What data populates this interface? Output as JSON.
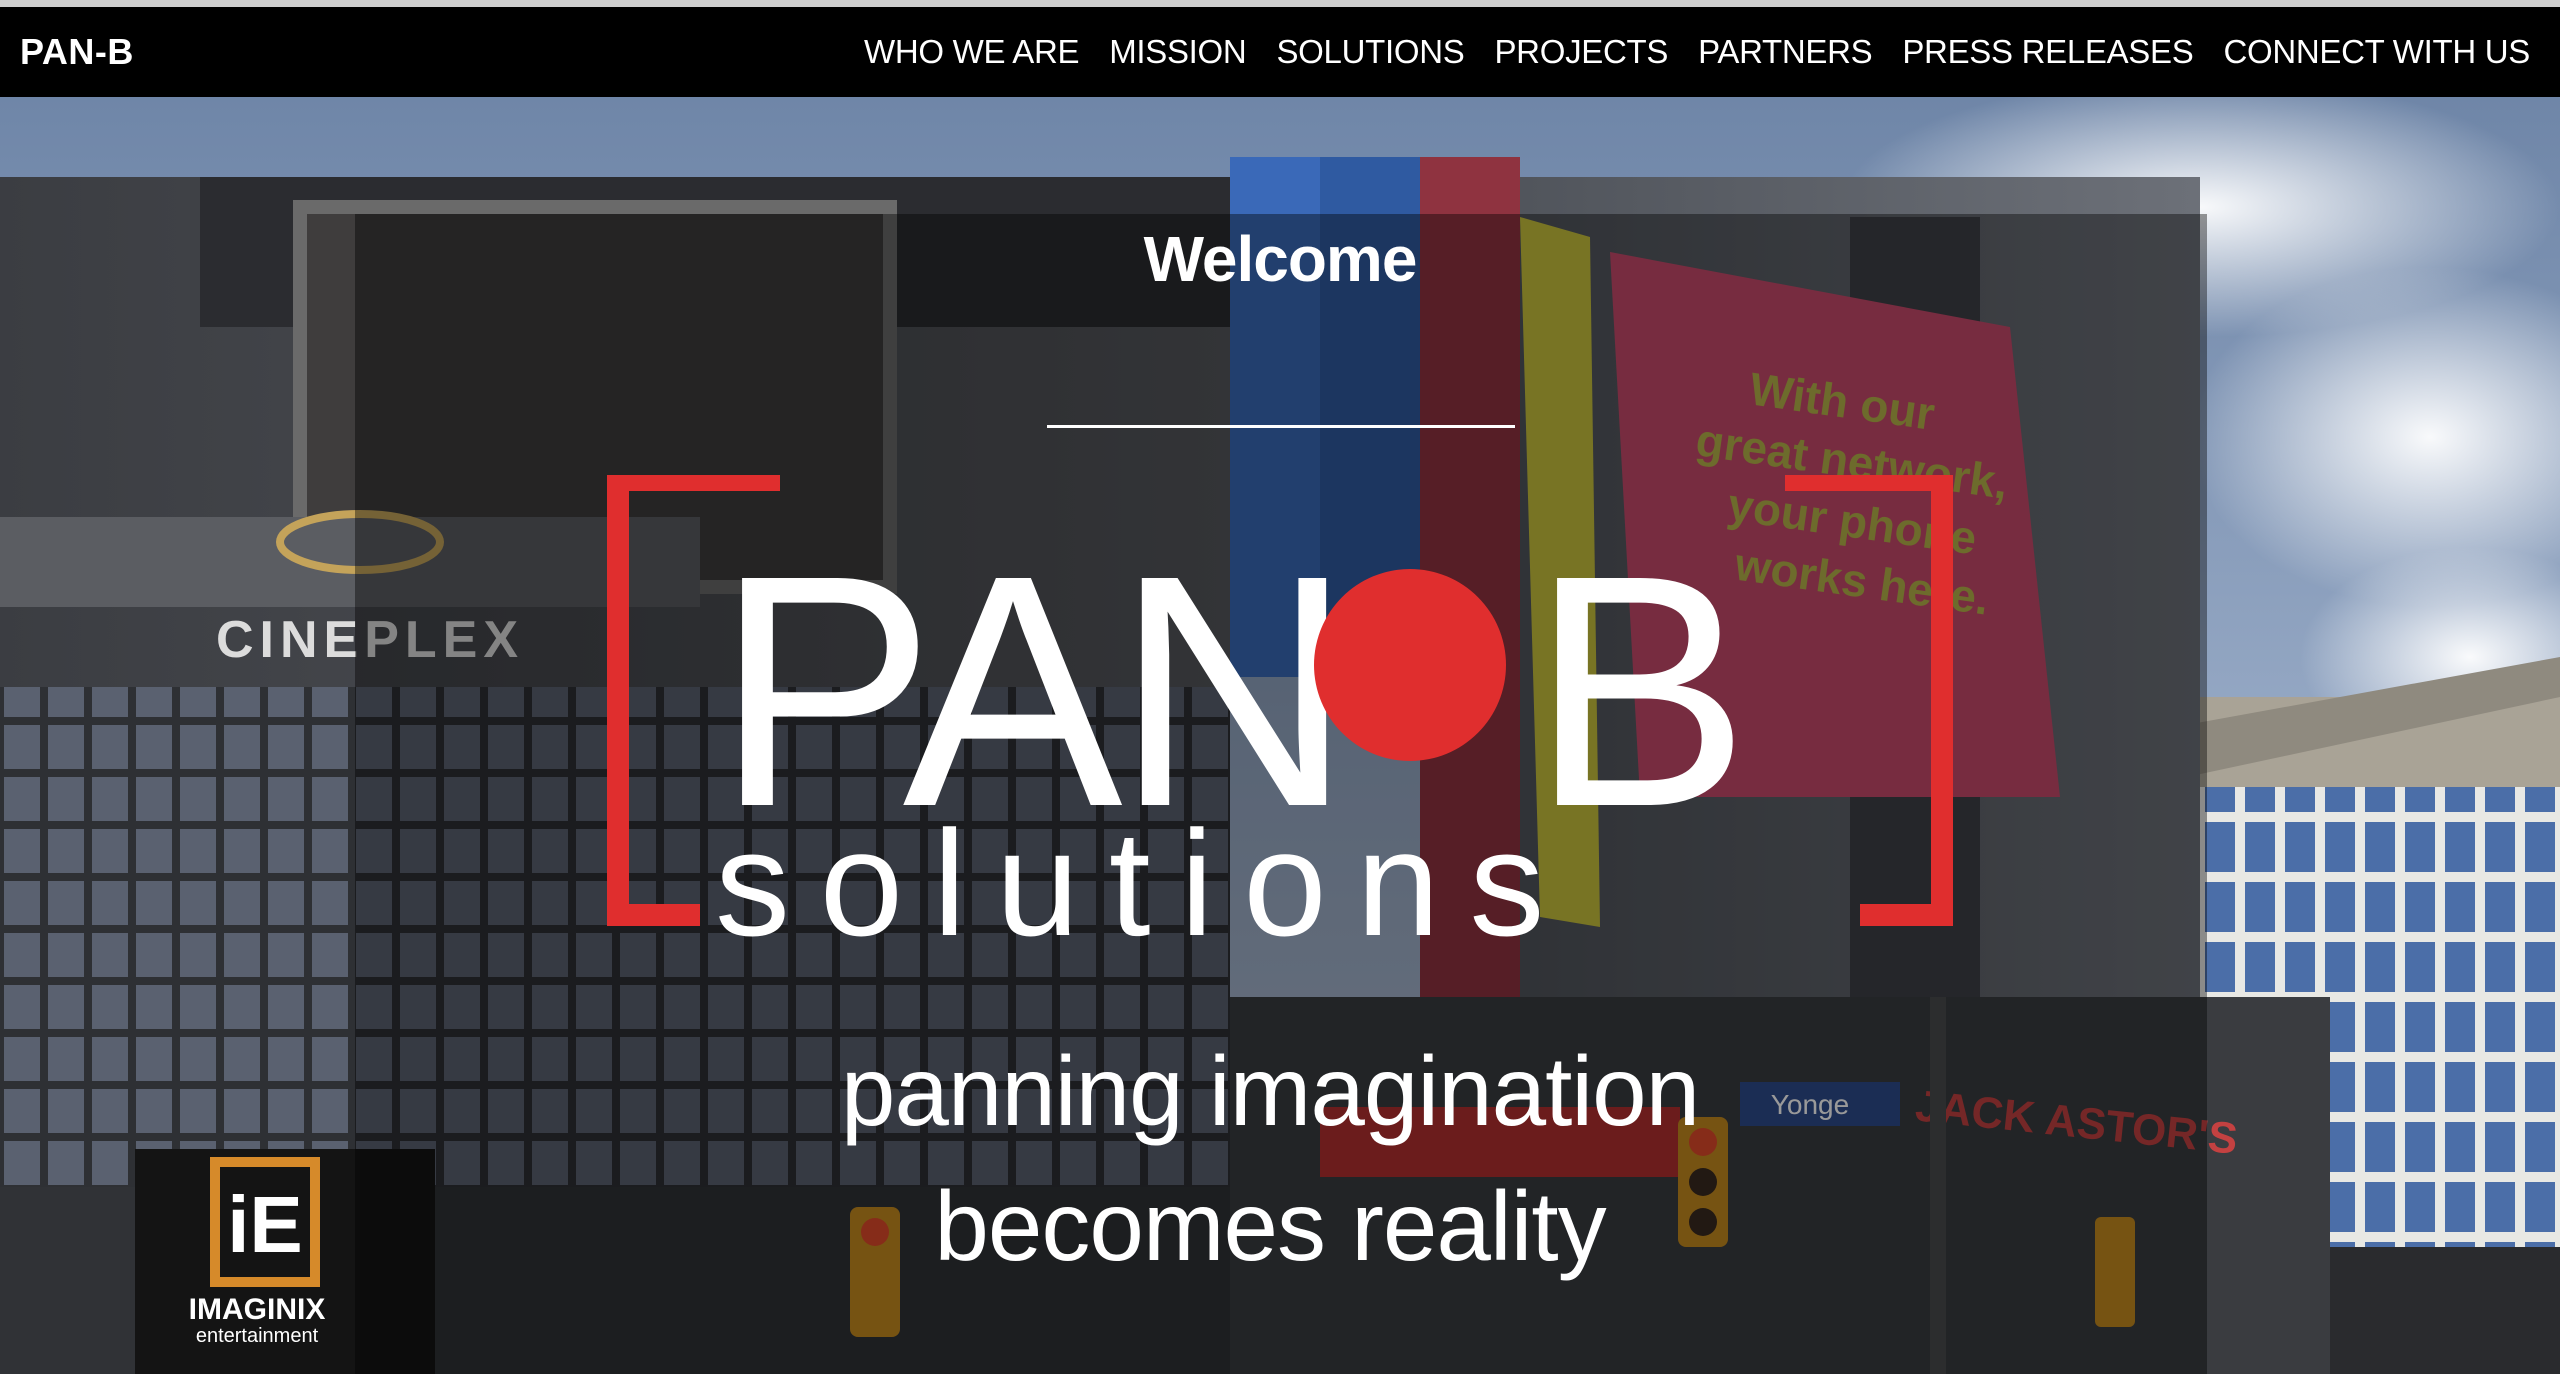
{
  "nav": {
    "brand": "PAN-B",
    "links": [
      "WHO WE ARE",
      "MISSION",
      "SOLUTIONS",
      "PROJECTS",
      "PARTNERS",
      "PRESS RELEASES",
      "CONNECT WITH US"
    ]
  },
  "hero": {
    "welcome": "Welcome",
    "logo": {
      "main_left": "PAN",
      "main_right": "B",
      "sub": "s o l u t i o n s"
    },
    "tagline_line1": "panning imagination",
    "tagline_line2": "becomes reality",
    "background_signs": {
      "cineplex": "CINEPLEX",
      "imaginix": "IMAGINIX",
      "imaginix_sub": "entertainment",
      "billboard": "With our great network, your phone works here.",
      "jack_astors": "JACK ASTOR'S",
      "yonge": "Yonge"
    }
  },
  "colors": {
    "brand_red": "#e02e2e",
    "nav_bg": "#000000",
    "text": "#ffffff"
  }
}
